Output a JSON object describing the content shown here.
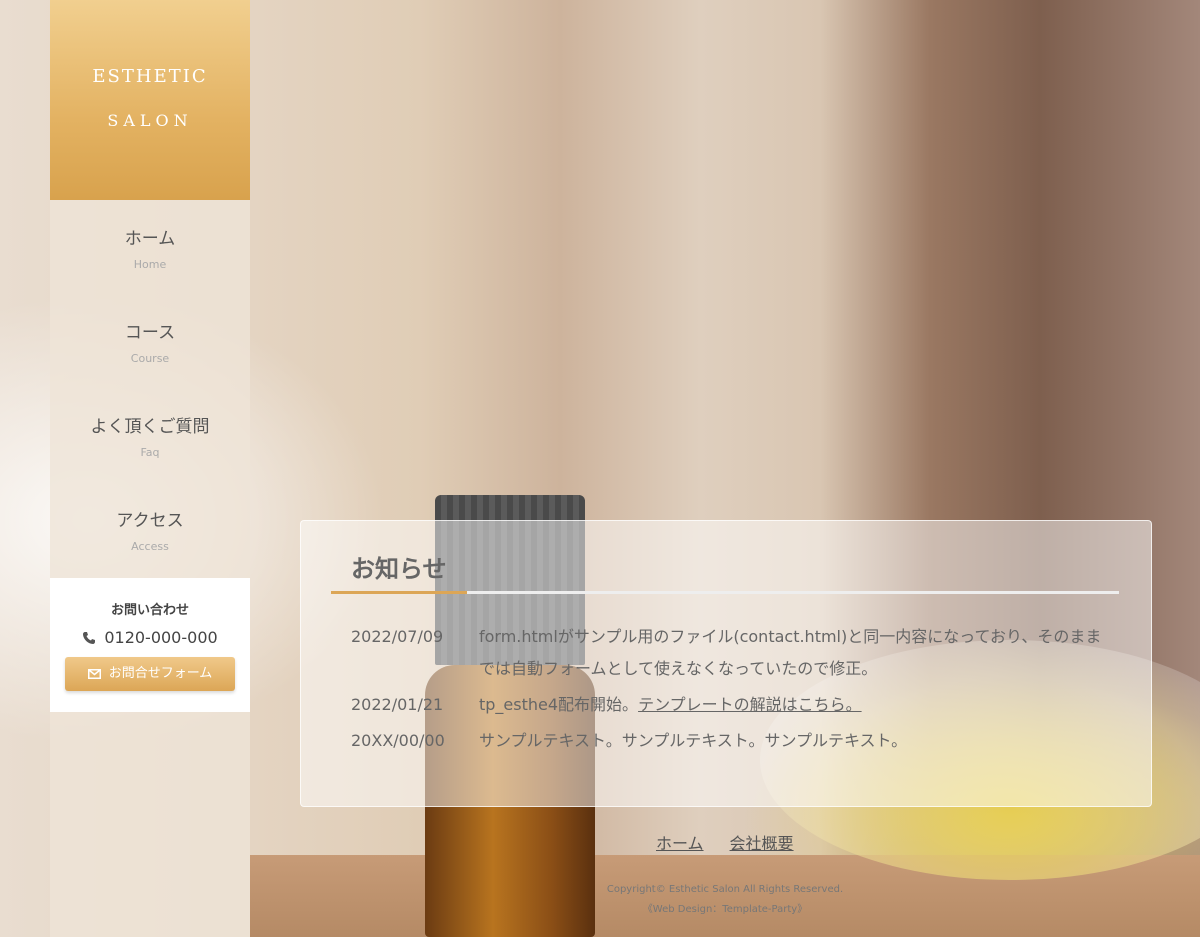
{
  "logo": {
    "line1": "ESTHETIC",
    "line2": "SALON"
  },
  "menu": [
    {
      "label": "ホーム",
      "sub": "Home"
    },
    {
      "label": "コース",
      "sub": "Course"
    },
    {
      "label": "よく頂くご質問",
      "sub": "Faq"
    },
    {
      "label": "アクセス",
      "sub": "Access"
    }
  ],
  "contact": {
    "title": "お問い合わせ",
    "tel": "0120-000-000",
    "button": "お問合せフォーム"
  },
  "news": {
    "title": "お知らせ",
    "items": [
      {
        "date": "2022/07/09",
        "text": "form.htmlがサンプル用のファイル(contact.html)と同一内容になっており、そのままでは自動フォームとして使えなくなっていたので修正。",
        "link": ""
      },
      {
        "date": "2022/01/21",
        "text": "tp_esthe4配布開始。",
        "link": "テンプレートの解説はこちら。"
      },
      {
        "date": "20XX/00/00",
        "text": "サンプルテキスト。サンプルテキスト。サンプルテキスト。",
        "link": ""
      }
    ]
  },
  "footer": {
    "nav": [
      "ホーム",
      "会社概要"
    ],
    "copyright": "Copyright© Esthetic Salon All Rights Reserved.",
    "credit": "《Web Design：Template-Party》"
  }
}
